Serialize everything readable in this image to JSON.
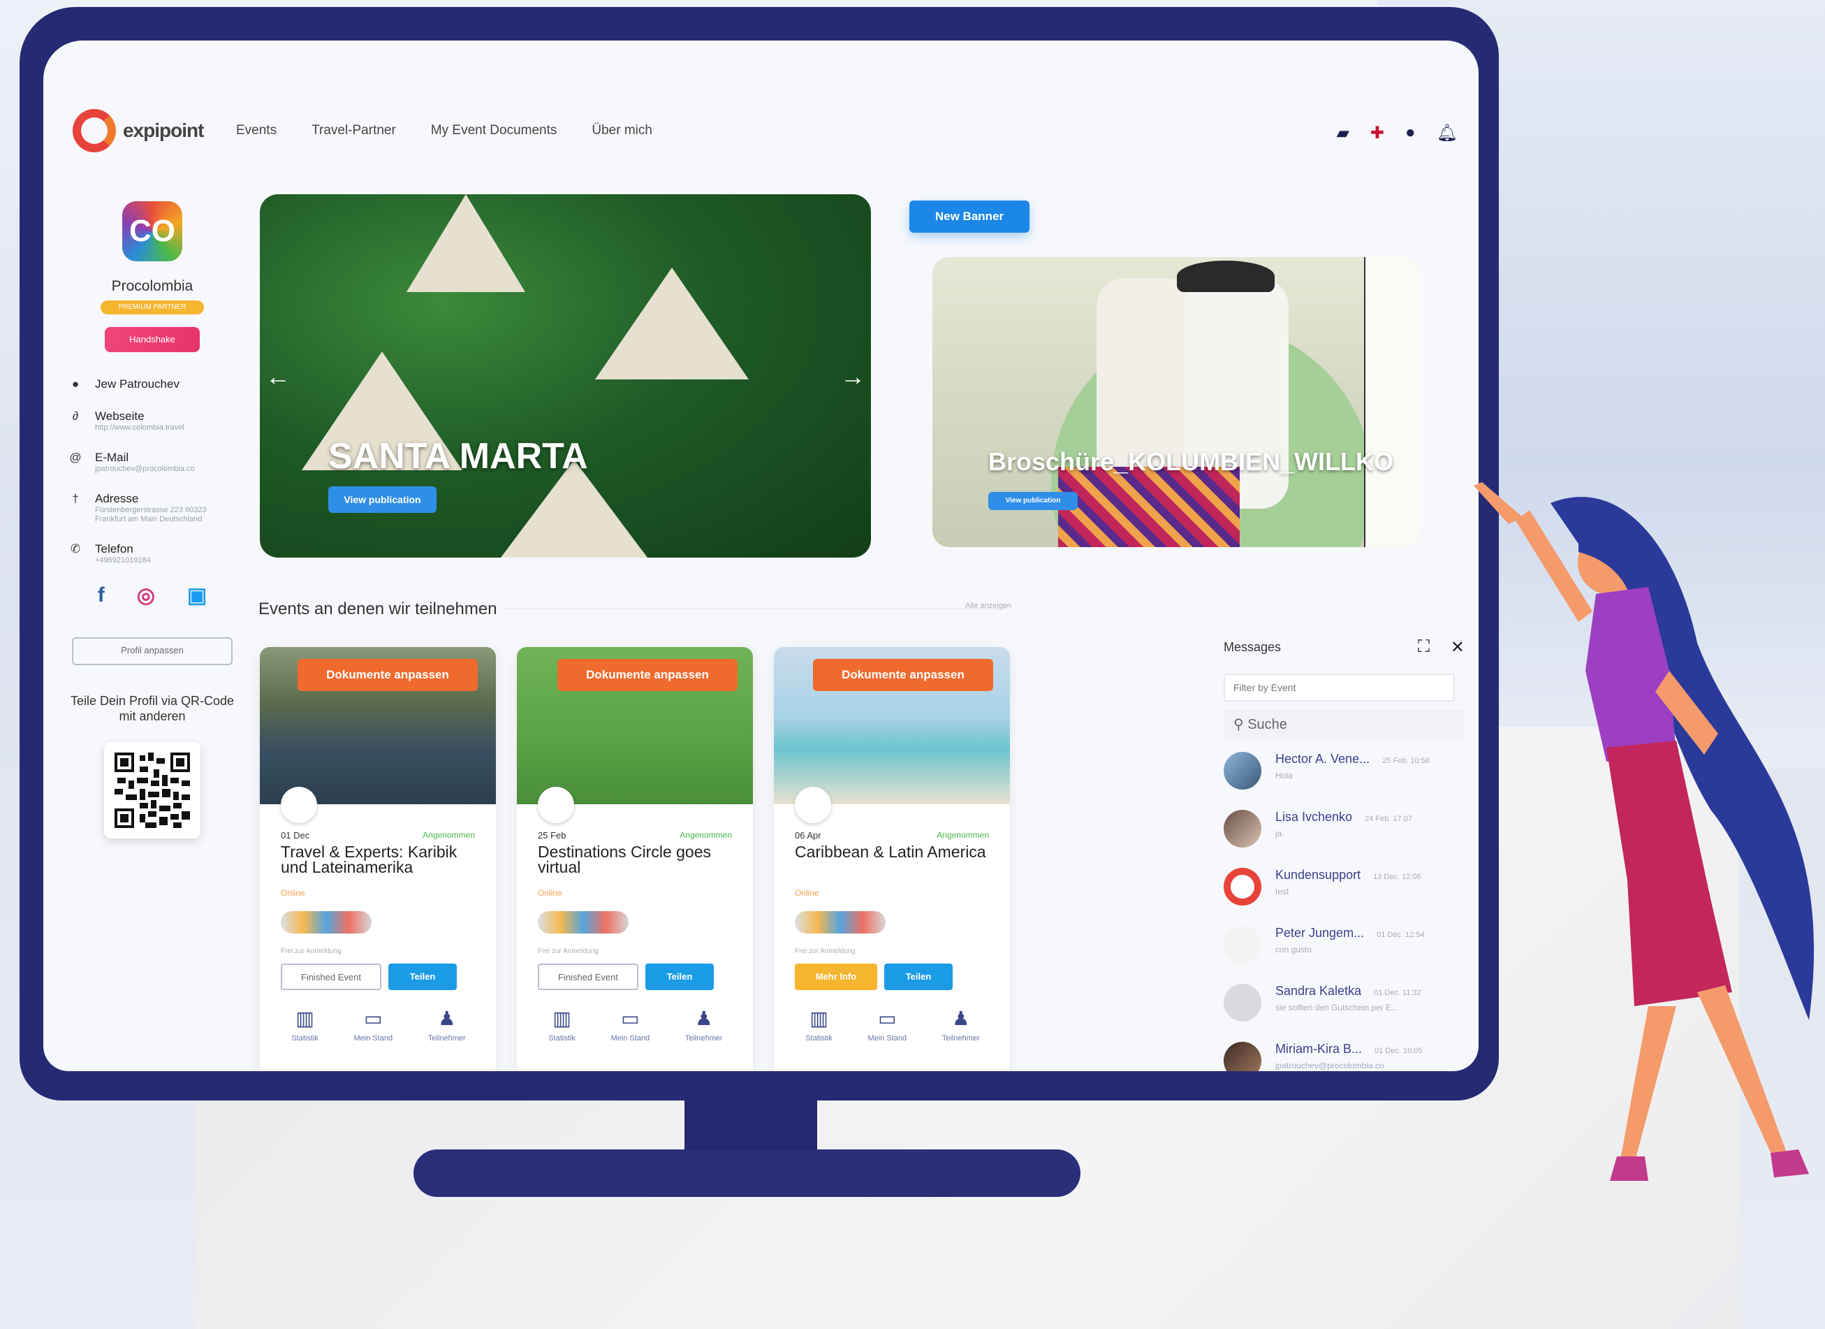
{
  "app": {
    "name": "expipoint"
  },
  "nav": [
    "Events",
    "Travel-Partner",
    "My Event Documents",
    "Über mich"
  ],
  "top_icons": [
    "folder-icon",
    "flag-uk-icon",
    "chat-icon",
    "bell-icon"
  ],
  "profile": {
    "logo_text": "CO",
    "name": "Procolombia",
    "badge": "PREMIUM PARTNER",
    "handshake": "Handshake",
    "contacts": [
      {
        "icon": "user-icon",
        "label": "Jew Patrouchev",
        "sub": ""
      },
      {
        "icon": "link-icon",
        "label": "Webseite",
        "sub": "http://www.colombia.travel"
      },
      {
        "icon": "at-icon",
        "label": "E-Mail",
        "sub": "jpatrouchev@procolombia.co"
      },
      {
        "icon": "pin-icon",
        "label": "Adresse",
        "sub": "Fürstenbergerstrasse 223 60323 Frankfurt am Main Deutschland"
      },
      {
        "icon": "phone-icon",
        "label": "Telefon",
        "sub": "+496921019184"
      }
    ],
    "edit_button": "Profil anpassen",
    "qr_text": "Teile Dein Profil via QR-Code mit anderen"
  },
  "hero": {
    "title": "SANTA MARTA",
    "button": "View publication"
  },
  "new_banner": "New Banner",
  "banner2": {
    "title": "Broschüre_KOLUMBIEN_WILLKO",
    "button": "View publication"
  },
  "events_section": {
    "title": "Events an denen wir teilnehmen",
    "link": "Alle anzeigen"
  },
  "events": [
    {
      "doc_button": "Dokumente anpassen",
      "date": "01 Dec",
      "status": "Angenommen",
      "title": "Travel & Experts: Karibik und Lateinamerika",
      "location": "Online",
      "note": "Frei zur Anmeldung",
      "btn1": "Finished Event",
      "btn2": "Teilen"
    },
    {
      "doc_button": "Dokumente anpassen",
      "date": "25 Feb",
      "status": "Angenommen",
      "title": "Destinations Circle goes virtual",
      "location": "Online",
      "note": "Frei zur Anmeldung",
      "btn1": "Finished Event",
      "btn2": "Teilen"
    },
    {
      "doc_button": "Dokumente anpassen",
      "date": "06 Apr",
      "status": "Angenommen",
      "title": "Caribbean & Latin America",
      "location": "Online",
      "note": "Frei zur Anmeldung",
      "btn1": "Mehr Info",
      "btn2": "Teilen"
    }
  ],
  "card_actions": [
    "Statistik",
    "Mein Stand",
    "Teilnehmer"
  ],
  "messages": {
    "title": "Messages",
    "filter_placeholder": "Filter by Event",
    "search_placeholder": "Suche",
    "items": [
      {
        "name": "Hector A. Vene...",
        "time": "25 Feb. 10:58",
        "preview": "Hola"
      },
      {
        "name": "Lisa Ivchenko",
        "time": "24 Feb. 17:07",
        "preview": "ja"
      },
      {
        "name": "Kundensupport",
        "time": "13 Dec. 12:06",
        "preview": "test"
      },
      {
        "name": "Peter Jungem...",
        "time": "01 Dec. 12:54",
        "preview": "con gusto"
      },
      {
        "name": "Sandra Kaletka",
        "time": "01 Dec. 11:32",
        "preview": "sie sollten den Gutschein per E..."
      },
      {
        "name": "Miriam-Kira B...",
        "time": "01 Dec. 10:05",
        "preview": "jpatrouchev@procolombia.co"
      }
    ]
  }
}
